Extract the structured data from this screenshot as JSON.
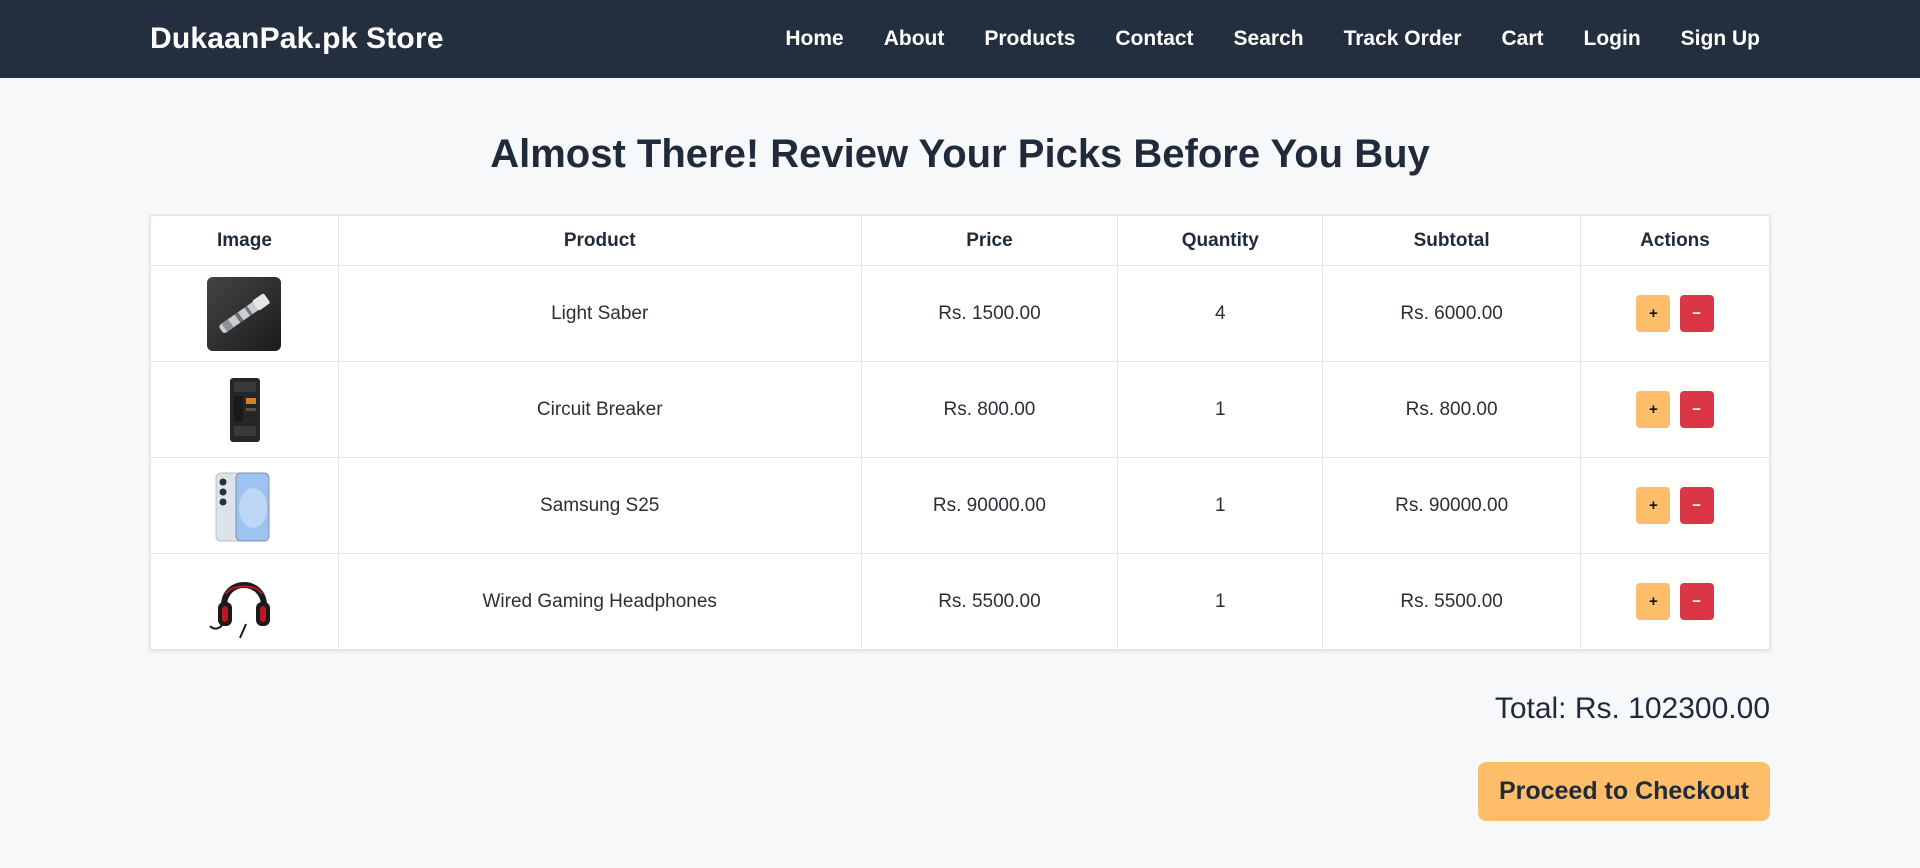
{
  "brand": "DukaanPak.pk Store",
  "nav": [
    "Home",
    "About",
    "Products",
    "Contact",
    "Search",
    "Track Order",
    "Cart",
    "Login",
    "Sign Up"
  ],
  "title": "Almost There! Review Your Picks Before You Buy",
  "table": {
    "headers": [
      "Image",
      "Product",
      "Price",
      "Quantity",
      "Subtotal",
      "Actions"
    ],
    "rows": [
      {
        "image": "light-saber-image",
        "product": "Light Saber",
        "price": "Rs. 1500.00",
        "quantity": "4",
        "subtotal": "Rs. 6000.00"
      },
      {
        "image": "circuit-breaker-image",
        "product": "Circuit Breaker",
        "price": "Rs. 800.00",
        "quantity": "1",
        "subtotal": "Rs. 800.00"
      },
      {
        "image": "samsung-phone-image",
        "product": "Samsung S25",
        "price": "Rs. 90000.00",
        "quantity": "1",
        "subtotal": "Rs. 90000.00"
      },
      {
        "image": "headphones-image",
        "product": "Wired Gaming Headphones",
        "price": "Rs. 5500.00",
        "quantity": "1",
        "subtotal": "Rs. 5500.00"
      }
    ],
    "actions": {
      "increase": "+",
      "decrease": "−"
    }
  },
  "total": "Total: Rs. 102300.00",
  "checkout_label": "Proceed to Checkout",
  "colors": {
    "navbar": "#232f3e",
    "accent": "#febd69",
    "danger": "#dc3545"
  }
}
